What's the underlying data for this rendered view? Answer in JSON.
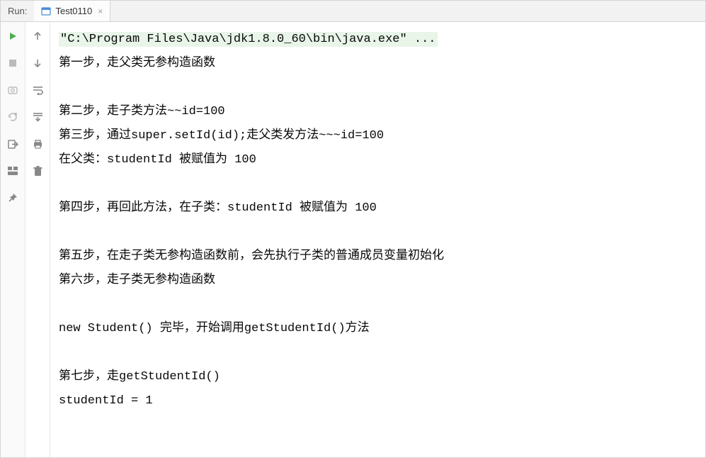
{
  "header": {
    "run_label": "Run:",
    "tab_name": "Test0110"
  },
  "icons": {
    "play": "play-icon",
    "stop": "stop-icon",
    "camera": "camera-icon",
    "bug_disabled": "bug-disabled-icon",
    "exit": "exit-icon",
    "layout": "layout-icon",
    "pin": "pin-icon",
    "arrow_up": "arrow-up-icon",
    "arrow_down": "arrow-down-icon",
    "wrap": "wrap-icon",
    "scroll": "scroll-to-end-icon",
    "print": "print-icon",
    "trash": "trash-icon"
  },
  "console": {
    "command": "\"C:\\Program Files\\Java\\jdk1.8.0_60\\bin\\java.exe\" ...",
    "lines": [
      "第一步，走父类无参构造函数",
      "",
      "第二步，走子类方法~~id=100",
      "第三步，通过super.setId(id);走父类发方法~~~id=100",
      "在父类：studentId 被赋值为 100",
      "",
      "第四步，再回此方法，在子类：studentId 被赋值为 100",
      "",
      "第五步，在走子类无参构造函数前，会先执行子类的普通成员变量初始化",
      "第六步，走子类无参构造函数",
      "",
      "new Student() 完毕，开始调用getStudentId()方法",
      "",
      "第七步，走getStudentId()",
      "studentId = 1"
    ]
  }
}
